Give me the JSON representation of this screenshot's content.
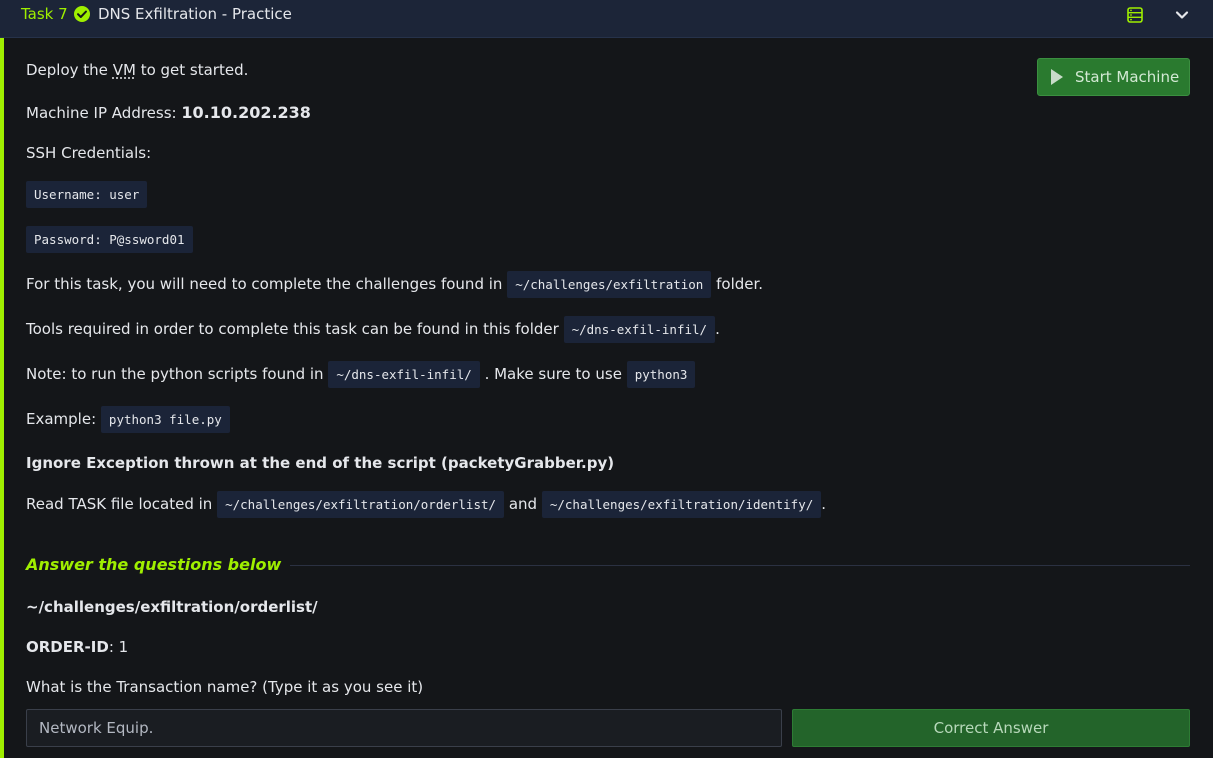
{
  "header": {
    "task_number": "Task 7",
    "title": "DNS Exfiltration - Practice"
  },
  "deploy": {
    "prefix": "Deploy the",
    "abbr": "VM",
    "suffix": "to get started.",
    "start_button": "Start Machine"
  },
  "machine": {
    "label": "Machine IP Address:",
    "ip": "10.10.202.238"
  },
  "ssh": {
    "label": "SSH Credentials:",
    "username": "Username: user",
    "password": "Password: P@ssword01"
  },
  "paragraphs": {
    "task_prefix": "For this task, you will need to complete the challenges found in",
    "task_code": "~/challenges/exfiltration",
    "task_suffix": "folder.",
    "tools_prefix": "Tools required in order to complete this task can be found in this folder",
    "tools_code": "~/dns-exfil-infil/",
    "tools_suffix": ".",
    "note_prefix": "Note: to run the python scripts found in",
    "note_code": "~/dns-exfil-infil/",
    "note_middle": ". Make sure to use",
    "note_code2": "python3",
    "example_label": "Example:",
    "example_code": "python3 file.py",
    "ignore": "Ignore Exception thrown at the end of the script (packetyGrabber.py)",
    "read_prefix": "Read TASK file located in",
    "read_code1": "~/challenges/exfiltration/orderlist/",
    "read_and": "and",
    "read_code2": "~/challenges/exfiltration/identify/",
    "read_suffix": "."
  },
  "questions": {
    "heading": "Answer the questions below",
    "path": "~/challenges/exfiltration/orderlist/",
    "order_label": "ORDER-ID",
    "order_value": ": 1",
    "question": "What is the Transaction name? (Type it as you see it)",
    "answer_value": "Network Equip.",
    "submit_label": "Correct Answer"
  },
  "colors": {
    "accent": "#9fef00",
    "header_bg": "#1c2538",
    "page_bg": "#141619",
    "button_green": "#2a7a2f"
  }
}
